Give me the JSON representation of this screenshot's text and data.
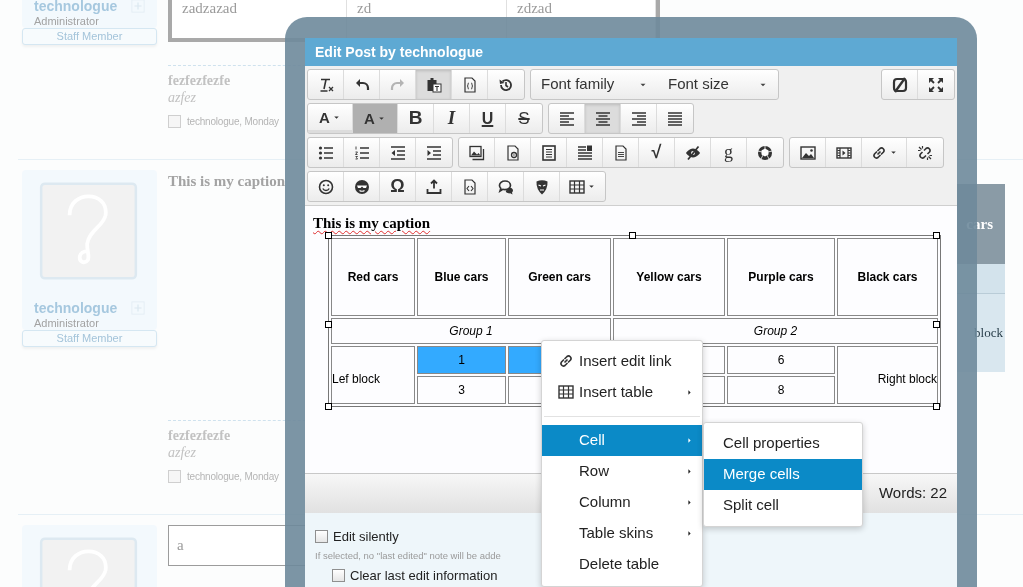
{
  "background": {
    "posts": [
      {
        "user": {
          "name": "technologue",
          "title": "Administrator",
          "badge": "Staff Member"
        },
        "content": {
          "kind": "table",
          "cells": [
            "zadzazad",
            "zd",
            "zdzad"
          ]
        },
        "signature": [
          "fezfezfezfe",
          "azfez"
        ],
        "meta": "technologue, Monday",
        "checked": false
      },
      {
        "user": {
          "name": "technologue",
          "title": "Administrator",
          "badge": "Staff Member",
          "avatar": true
        },
        "content": {
          "kind": "caption",
          "caption": "This is my caption",
          "cells": [
            "cars",
            "block"
          ]
        },
        "signature": [
          "fezfezfezfe",
          "azfez"
        ],
        "meta": "technologue, Monday",
        "checked": false
      },
      {
        "user": {
          "avatar": true
        },
        "content": {
          "kind": "input",
          "value": "a"
        }
      }
    ]
  },
  "dialog": {
    "title": "Edit Post by technologue",
    "toolbar": [
      [
        [
          {
            "kind": "icon",
            "pressed": false,
            "disabled": false
          },
          {
            "kind": "icon",
            "pressed": false,
            "disabled": false
          },
          {
            "kind": "icon",
            "pressed": false,
            "disabled": true
          },
          {
            "kind": "icon",
            "pressed": true,
            "disabled": false
          },
          {
            "kind": "icon",
            "pressed": false,
            "disabled": false
          },
          {
            "kind": "icon",
            "pressed": false,
            "disabled": false
          }
        ],
        [
          {
            "kind": "select",
            "label": "Font family"
          },
          {
            "kind": "select",
            "label": "Font size"
          }
        ],
        [
          {
            "kind": "icon",
            "pressed": false,
            "disabled": false
          },
          {
            "kind": "icon",
            "pressed": false,
            "disabled": false
          }
        ]
      ],
      [
        [
          {
            "kind": "forecolor",
            "glyph": "A",
            "caret": true,
            "pressed": false,
            "disabled": false
          },
          {
            "kind": "backcolor",
            "glyph": "A",
            "caret": true,
            "pressed": false,
            "disabled": false
          },
          {
            "kind": "bold",
            "glyph": "B",
            "pressed": false,
            "disabled": false
          },
          {
            "kind": "italic",
            "glyph": "I",
            "pressed": false,
            "disabled": false
          },
          {
            "kind": "underline",
            "glyph": "U",
            "pressed": false,
            "disabled": false
          },
          {
            "kind": "strike",
            "glyph": "S",
            "pressed": false,
            "disabled": false
          }
        ],
        [
          {
            "kind": "icon",
            "pressed": false,
            "disabled": false
          },
          {
            "kind": "icon",
            "pressed": true,
            "disabled": false
          },
          {
            "kind": "icon",
            "pressed": false,
            "disabled": false
          },
          {
            "kind": "icon",
            "pressed": false,
            "disabled": false
          }
        ]
      ],
      [
        [
          {
            "kind": "icon",
            "pressed": false,
            "disabled": false
          },
          {
            "kind": "icon",
            "pressed": false,
            "disabled": false
          },
          {
            "kind": "icon",
            "pressed": false,
            "disabled": false
          },
          {
            "kind": "icon",
            "pressed": false,
            "disabled": false
          }
        ],
        [
          {
            "kind": "icon",
            "pressed": false,
            "disabled": false
          },
          {
            "kind": "icon",
            "pressed": false,
            "disabled": false
          },
          {
            "kind": "icon",
            "pressed": false,
            "disabled": false
          },
          {
            "kind": "icon",
            "pressed": false,
            "disabled": false
          },
          {
            "kind": "icon",
            "pressed": false,
            "disabled": false
          },
          {
            "kind": "glyph",
            "glyph": "√",
            "pressed": false,
            "disabled": false
          },
          {
            "kind": "icon",
            "pressed": false,
            "disabled": false
          },
          {
            "kind": "serif",
            "glyph": "g",
            "pressed": false,
            "disabled": false
          },
          {
            "kind": "icon",
            "pressed": false,
            "disabled": false
          }
        ],
        [
          {
            "kind": "icon",
            "pressed": false,
            "disabled": false
          },
          {
            "kind": "icon",
            "pressed": false,
            "disabled": false
          },
          {
            "kind": "icon",
            "caret": true,
            "pressed": false,
            "disabled": false
          },
          {
            "kind": "icon",
            "pressed": false,
            "disabled": false
          }
        ]
      ],
      [
        [
          {
            "kind": "icon",
            "pressed": false,
            "disabled": false
          },
          {
            "kind": "icon",
            "pressed": false,
            "disabled": false
          },
          {
            "kind": "glyph",
            "glyph": "Ω",
            "pressed": false,
            "disabled": false
          },
          {
            "kind": "icon",
            "pressed": false,
            "disabled": false
          },
          {
            "kind": "icon",
            "pressed": false,
            "disabled": false
          },
          {
            "kind": "icon",
            "pressed": false,
            "disabled": false
          },
          {
            "kind": "icon",
            "pressed": false,
            "disabled": false
          },
          {
            "kind": "icon",
            "caret": true,
            "pressed": false,
            "disabled": false
          }
        ]
      ]
    ],
    "editor": {
      "caption": "This is my caption",
      "rows": [
        [
          {
            "text": "Red cars",
            "header": true
          },
          {
            "text": "Blue cars",
            "header": true
          },
          {
            "text": "Green cars",
            "header": true
          },
          {
            "text": "Yellow cars",
            "header": true
          },
          {
            "text": "Purple cars",
            "header": true
          },
          {
            "text": "Black cars",
            "header": true
          }
        ],
        [
          {
            "text": "Group 1",
            "colspan": 3,
            "group": true
          },
          {
            "text": "Group 2",
            "colspan": 3,
            "group": true
          }
        ],
        [
          {
            "text": "Lef block",
            "rowspan": 2,
            "selected": false
          },
          {
            "text": "1",
            "selected": true
          },
          {
            "selected": true
          },
          {
            "selected": false
          },
          {
            "text": "6",
            "selected": false
          },
          {
            "text": "Right block",
            "rowspan": 2,
            "selected": false
          }
        ],
        [
          {
            "text": "3",
            "selected": false
          },
          {
            "selected": false
          },
          {
            "selected": false
          },
          {
            "text": "8",
            "selected": false
          }
        ]
      ]
    },
    "word_count": "Words: 22",
    "options": [
      {
        "label": "Edit silently",
        "checked": false,
        "hint": "If selected, no \"last edited\" note will be adde"
      },
      {
        "label": "Clear last edit information",
        "checked": false
      }
    ]
  },
  "context_menu": {
    "items": [
      {
        "kind": "item",
        "label": "Insert edit link",
        "selected": false,
        "submenu": false
      },
      {
        "kind": "item",
        "label": "Insert table",
        "selected": false,
        "submenu": true
      },
      {
        "kind": "separator"
      },
      {
        "kind": "item",
        "label": "Cell",
        "selected": true,
        "submenu": true
      },
      {
        "kind": "item",
        "label": "Row",
        "selected": false,
        "submenu": true
      },
      {
        "kind": "item",
        "label": "Column",
        "selected": false,
        "submenu": true
      },
      {
        "kind": "item",
        "label": "Table skins",
        "selected": false,
        "submenu": true
      },
      {
        "kind": "item",
        "label": "Delete table",
        "selected": false,
        "submenu": false
      }
    ],
    "submenu": {
      "items": [
        {
          "label": "Cell properties",
          "selected": false
        },
        {
          "label": "Merge cells",
          "selected": true
        },
        {
          "label": "Split cell",
          "selected": false
        }
      ]
    }
  }
}
